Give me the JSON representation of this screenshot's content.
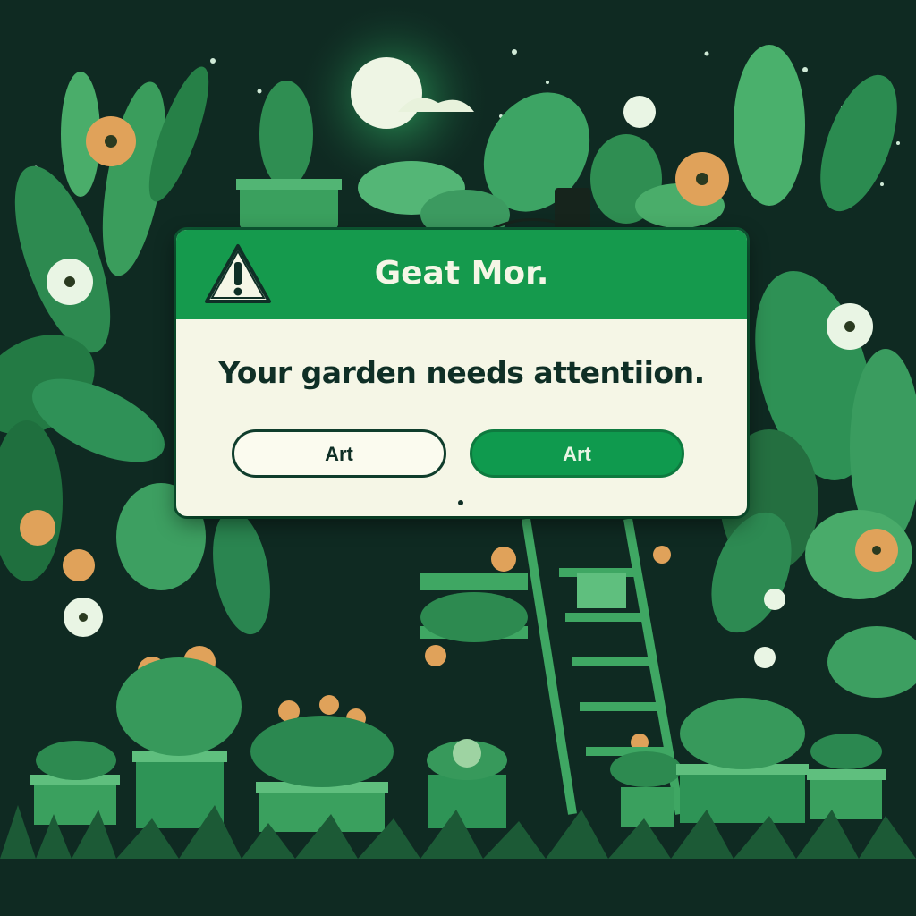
{
  "dialog": {
    "title": "Geat Mor.",
    "message": "Your garden needs attentiion.",
    "buttons": [
      {
        "label": "Art",
        "style": "outline"
      },
      {
        "label": "Art",
        "style": "filled"
      }
    ]
  },
  "colors": {
    "background": "#0f2a22",
    "header": "#159a4d",
    "dialog_body": "#f5f6e6",
    "primary_button": "#0f9a4e",
    "flower_orange": "#e0a25a"
  },
  "icons": [
    "warning-icon",
    "moon-icon",
    "ladder-icon",
    "plant-pot-icon",
    "flower-icon"
  ]
}
